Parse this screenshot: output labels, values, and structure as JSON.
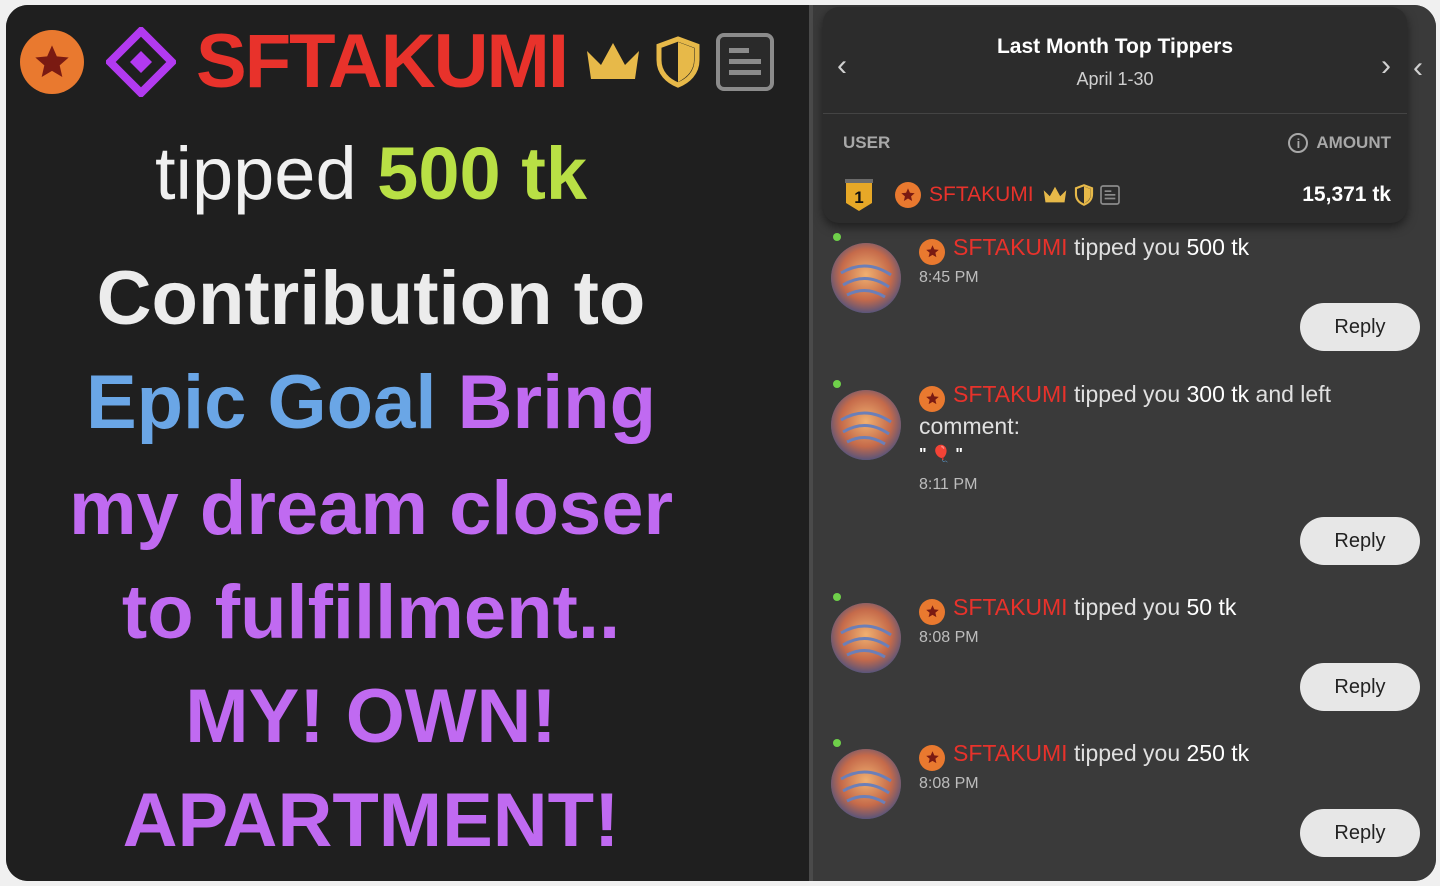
{
  "alert": {
    "username": "SFTAKUMI",
    "tipped_word": "tipped",
    "amount": "500 tk",
    "line_contribution": "Contribution to",
    "goal_label": "Epic Goal",
    "goal_word": "Bring",
    "line_dream": "my dream closer",
    "line_fulfillment": "to fulfillment..",
    "line_own": "MY! OWN!",
    "line_apartment": "APARTMENT!"
  },
  "top_tippers": {
    "title": "Last Month Top Tippers",
    "period": "April 1-30",
    "col_user": "USER",
    "col_amount": "AMOUNT",
    "rank": "1",
    "username": "SFTAKUMI",
    "amount": "15,371 tk"
  },
  "messages": [
    {
      "username": "SFTAKUMI",
      "text": "tipped you",
      "amount": "500 tk",
      "time": "8:45 PM",
      "reply": "Reply"
    },
    {
      "username": "SFTAKUMI",
      "text": "tipped you",
      "amount": "300 tk",
      "suffix": "and left comment:",
      "comment": "\" 🎈 \"",
      "time": "8:11 PM",
      "reply": "Reply"
    },
    {
      "username": "SFTAKUMI",
      "text": "tipped you",
      "amount": "50 tk",
      "time": "8:08 PM",
      "reply": "Reply"
    },
    {
      "username": "SFTAKUMI",
      "text": "tipped you",
      "amount": "250 tk",
      "time": "8:08 PM",
      "reply": "Reply"
    }
  ],
  "colors": {
    "username": "#e8322b",
    "amount_green": "#b9e045",
    "goal_blue": "#6aa6e6",
    "purple": "#c06af1",
    "badge_orange": "#e9792f",
    "crown_gold": "#e7b949"
  },
  "icons": [
    "star-badge-icon",
    "diamond-icon",
    "crown-icon",
    "shield-icon",
    "document-icon",
    "chevron-left-icon",
    "chevron-right-icon",
    "info-icon",
    "rank-medal-icon"
  ]
}
